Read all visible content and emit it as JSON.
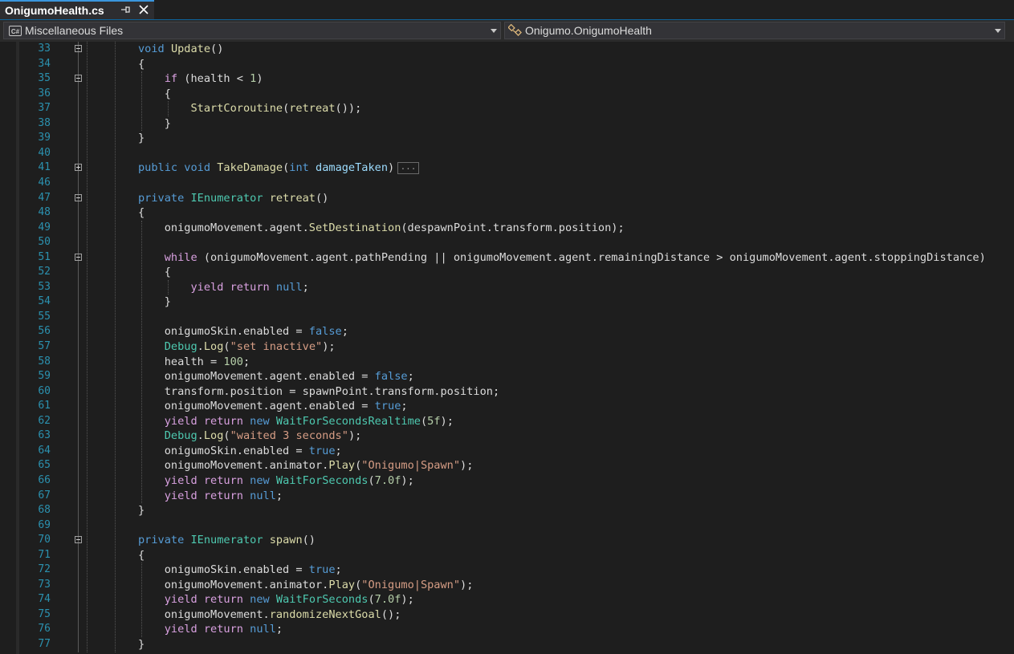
{
  "tab": {
    "title": "OnigumoHealth.cs",
    "active": true
  },
  "navbar": {
    "project_dropdown": "Miscellaneous Files",
    "project_icon": "csharp-project-icon",
    "type_dropdown": "Onigumo.OnigumoHealth",
    "type_icon": "class-icon"
  },
  "editor": {
    "lines": [
      {
        "num": "33",
        "fold": "expanded",
        "code": [
          [
            "k",
            "void"
          ],
          [
            "",
            "",
            " "
          ],
          [
            "m",
            "Update"
          ],
          [
            "",
            "()"
          ]
        ]
      },
      {
        "num": "34",
        "code": [
          [
            "",
            "{"
          ]
        ]
      },
      {
        "num": "35",
        "fold": "expanded",
        "code": [
          [
            "",
            "    "
          ],
          [
            "c",
            "if"
          ],
          [
            "",
            " (health < "
          ],
          [
            "n",
            "1"
          ],
          [
            "",
            ")"
          ]
        ]
      },
      {
        "num": "36",
        "code": [
          [
            "",
            "    {"
          ]
        ]
      },
      {
        "num": "37",
        "code": [
          [
            "",
            "        "
          ],
          [
            "m",
            "StartCoroutine"
          ],
          [
            "",
            "("
          ],
          [
            "m",
            "retreat"
          ],
          [
            "",
            "());"
          ]
        ]
      },
      {
        "num": "38",
        "code": [
          [
            "",
            "    }"
          ]
        ]
      },
      {
        "num": "39",
        "code": [
          [
            "",
            "}"
          ]
        ]
      },
      {
        "num": "40",
        "code": []
      },
      {
        "num": "41",
        "fold": "collapsed",
        "ellipsis": "...",
        "code": [
          [
            "k",
            "public"
          ],
          [
            "",
            " "
          ],
          [
            "k",
            "void"
          ],
          [
            "",
            " "
          ],
          [
            "m",
            "TakeDamage"
          ],
          [
            "",
            "("
          ],
          [
            "k",
            "int"
          ],
          [
            "",
            " "
          ],
          [
            "v",
            "damageTaken"
          ],
          [
            "",
            ")"
          ]
        ]
      },
      {
        "num": "46",
        "code": []
      },
      {
        "num": "47",
        "fold": "expanded",
        "code": [
          [
            "k",
            "private"
          ],
          [
            "",
            " "
          ],
          [
            "t",
            "IEnumerator"
          ],
          [
            "",
            " "
          ],
          [
            "m",
            "retreat"
          ],
          [
            "",
            "()"
          ]
        ]
      },
      {
        "num": "48",
        "code": [
          [
            "",
            "{"
          ]
        ]
      },
      {
        "num": "49",
        "code": [
          [
            "",
            "    onigumoMovement.agent."
          ],
          [
            "m",
            "SetDestination"
          ],
          [
            "",
            "(despawnPoint.transform.position);"
          ]
        ]
      },
      {
        "num": "50",
        "code": []
      },
      {
        "num": "51",
        "fold": "expanded",
        "code": [
          [
            "",
            "    "
          ],
          [
            "c",
            "while"
          ],
          [
            "",
            " (onigumoMovement.agent.pathPending || onigumoMovement.agent.remainingDistance > onigumoMovement.agent.stoppingDistance)"
          ]
        ]
      },
      {
        "num": "52",
        "code": [
          [
            "",
            "    {"
          ]
        ]
      },
      {
        "num": "53",
        "code": [
          [
            "",
            "        "
          ],
          [
            "c",
            "yield"
          ],
          [
            "",
            " "
          ],
          [
            "c",
            "return"
          ],
          [
            "",
            " "
          ],
          [
            "k",
            "null"
          ],
          [
            "",
            ";"
          ]
        ]
      },
      {
        "num": "54",
        "code": [
          [
            "",
            "    }"
          ]
        ]
      },
      {
        "num": "55",
        "code": []
      },
      {
        "num": "56",
        "code": [
          [
            "",
            "    onigumoSkin.enabled = "
          ],
          [
            "k",
            "false"
          ],
          [
            "",
            ";"
          ]
        ]
      },
      {
        "num": "57",
        "code": [
          [
            "",
            "    "
          ],
          [
            "t",
            "Debug"
          ],
          [
            "",
            "."
          ],
          [
            "m",
            "Log"
          ],
          [
            "",
            "("
          ],
          [
            "s",
            "\"set inactive\""
          ],
          [
            "",
            ");"
          ]
        ]
      },
      {
        "num": "58",
        "code": [
          [
            "",
            "    health = "
          ],
          [
            "n",
            "100"
          ],
          [
            "",
            ";"
          ]
        ]
      },
      {
        "num": "59",
        "code": [
          [
            "",
            "    onigumoMovement.agent.enabled = "
          ],
          [
            "k",
            "false"
          ],
          [
            "",
            ";"
          ]
        ]
      },
      {
        "num": "60",
        "code": [
          [
            "",
            "    transform.position = spawnPoint.transform.position;"
          ]
        ]
      },
      {
        "num": "61",
        "code": [
          [
            "",
            "    onigumoMovement.agent.enabled = "
          ],
          [
            "k",
            "true"
          ],
          [
            "",
            ";"
          ]
        ]
      },
      {
        "num": "62",
        "code": [
          [
            "",
            "    "
          ],
          [
            "c",
            "yield"
          ],
          [
            "",
            " "
          ],
          [
            "c",
            "return"
          ],
          [
            "",
            " "
          ],
          [
            "k",
            "new"
          ],
          [
            "",
            " "
          ],
          [
            "t",
            "WaitForSecondsRealtime"
          ],
          [
            "",
            "("
          ],
          [
            "n",
            "5f"
          ],
          [
            "",
            ");"
          ]
        ]
      },
      {
        "num": "63",
        "code": [
          [
            "",
            "    "
          ],
          [
            "t",
            "Debug"
          ],
          [
            "",
            "."
          ],
          [
            "m",
            "Log"
          ],
          [
            "",
            "("
          ],
          [
            "s",
            "\"waited 3 seconds\""
          ],
          [
            "",
            ");"
          ]
        ]
      },
      {
        "num": "64",
        "code": [
          [
            "",
            "    onigumoSkin.enabled = "
          ],
          [
            "k",
            "true"
          ],
          [
            "",
            ";"
          ]
        ]
      },
      {
        "num": "65",
        "code": [
          [
            "",
            "    onigumoMovement.animator."
          ],
          [
            "m",
            "Play"
          ],
          [
            "",
            "("
          ],
          [
            "s",
            "\"Onigumo|Spawn\""
          ],
          [
            "",
            ");"
          ]
        ]
      },
      {
        "num": "66",
        "code": [
          [
            "",
            "    "
          ],
          [
            "c",
            "yield"
          ],
          [
            "",
            " "
          ],
          [
            "c",
            "return"
          ],
          [
            "",
            " "
          ],
          [
            "k",
            "new"
          ],
          [
            "",
            " "
          ],
          [
            "t",
            "WaitForSeconds"
          ],
          [
            "",
            "("
          ],
          [
            "n",
            "7.0f"
          ],
          [
            "",
            ");"
          ]
        ]
      },
      {
        "num": "67",
        "code": [
          [
            "",
            "    "
          ],
          [
            "c",
            "yield"
          ],
          [
            "",
            " "
          ],
          [
            "c",
            "return"
          ],
          [
            "",
            " "
          ],
          [
            "k",
            "null"
          ],
          [
            "",
            ";"
          ]
        ]
      },
      {
        "num": "68",
        "code": [
          [
            "",
            "}"
          ]
        ]
      },
      {
        "num": "69",
        "code": []
      },
      {
        "num": "70",
        "fold": "expanded",
        "code": [
          [
            "k",
            "private"
          ],
          [
            "",
            " "
          ],
          [
            "t",
            "IEnumerator"
          ],
          [
            "",
            " "
          ],
          [
            "m",
            "spawn"
          ],
          [
            "",
            "()"
          ]
        ]
      },
      {
        "num": "71",
        "code": [
          [
            "",
            "{"
          ]
        ]
      },
      {
        "num": "72",
        "code": [
          [
            "",
            "    onigumoSkin.enabled = "
          ],
          [
            "k",
            "true"
          ],
          [
            "",
            ";"
          ]
        ]
      },
      {
        "num": "73",
        "code": [
          [
            "",
            "    onigumoMovement.animator."
          ],
          [
            "m",
            "Play"
          ],
          [
            "",
            "("
          ],
          [
            "s",
            "\"Onigumo|Spawn\""
          ],
          [
            "",
            ");"
          ]
        ]
      },
      {
        "num": "74",
        "code": [
          [
            "",
            "    "
          ],
          [
            "c",
            "yield"
          ],
          [
            "",
            " "
          ],
          [
            "c",
            "return"
          ],
          [
            "",
            " "
          ],
          [
            "k",
            "new"
          ],
          [
            "",
            " "
          ],
          [
            "t",
            "WaitForSeconds"
          ],
          [
            "",
            "("
          ],
          [
            "n",
            "7.0f"
          ],
          [
            "",
            ");"
          ]
        ]
      },
      {
        "num": "75",
        "code": [
          [
            "",
            "    onigumoMovement."
          ],
          [
            "m",
            "randomizeNextGoal"
          ],
          [
            "",
            "();"
          ]
        ]
      },
      {
        "num": "76",
        "code": [
          [
            "",
            "    "
          ],
          [
            "c",
            "yield"
          ],
          [
            "",
            " "
          ],
          [
            "c",
            "return"
          ],
          [
            "",
            " "
          ],
          [
            "k",
            "null"
          ],
          [
            "",
            ";"
          ]
        ]
      },
      {
        "num": "77",
        "code": [
          [
            "",
            "}"
          ]
        ]
      }
    ]
  }
}
